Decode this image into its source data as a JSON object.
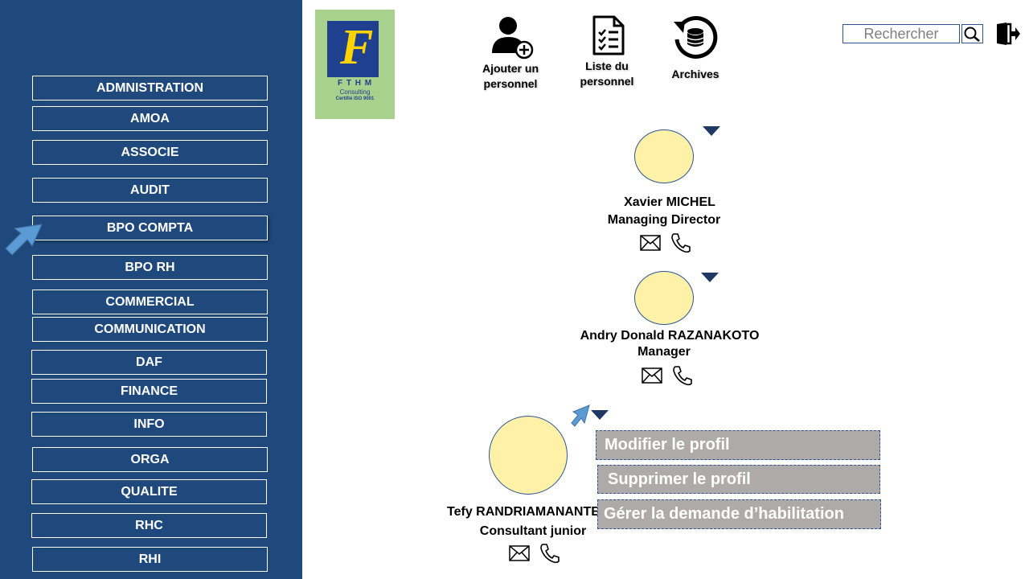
{
  "sidebar": {
    "items": [
      {
        "label": "ADMNISTRATION"
      },
      {
        "label": "AMOA"
      },
      {
        "label": "ASSOCIE"
      },
      {
        "label": "AUDIT"
      },
      {
        "label": "BPO COMPTA"
      },
      {
        "label": "BPO RH"
      },
      {
        "label": "COMMERCIAL"
      },
      {
        "label": "COMMUNICATION"
      },
      {
        "label": "DAF"
      },
      {
        "label": "FINANCE"
      },
      {
        "label": "INFO"
      },
      {
        "label": "ORGA"
      },
      {
        "label": "QUALITE"
      },
      {
        "label": "RHC"
      },
      {
        "label": "RHI"
      }
    ],
    "active": "BPO COMPTA"
  },
  "logo": {
    "letter": "F",
    "name": "F T H M",
    "sub": "Consulting",
    "cert": "Certifié ISO 9001"
  },
  "toolbar": {
    "add_label_1": "Ajouter un",
    "add_label_2": "personnel",
    "list_label_1": "Liste du",
    "list_label_2": "personnel",
    "archives_label": "Archives"
  },
  "search": {
    "placeholder": "Rechercher"
  },
  "people": [
    {
      "name": "Xavier MICHEL",
      "role": "Managing Director"
    },
    {
      "name": "Andry Donald RAZANAKOTO",
      "role": "Manager"
    },
    {
      "name": "Tefy RANDRIAMANANTE",
      "role": "Consultant junior"
    }
  ],
  "context_menu": {
    "edit": "Modifier le profil",
    "delete": "Supprimer le profil",
    "manage": "Gérer la demande d’habilitation"
  },
  "colors": {
    "sidebar": "#1f497d",
    "avatar": "#fff2a8",
    "menu": "#aeaaaa",
    "logo_bg": "#a9d18e",
    "arrow": "#5b9bd5"
  }
}
